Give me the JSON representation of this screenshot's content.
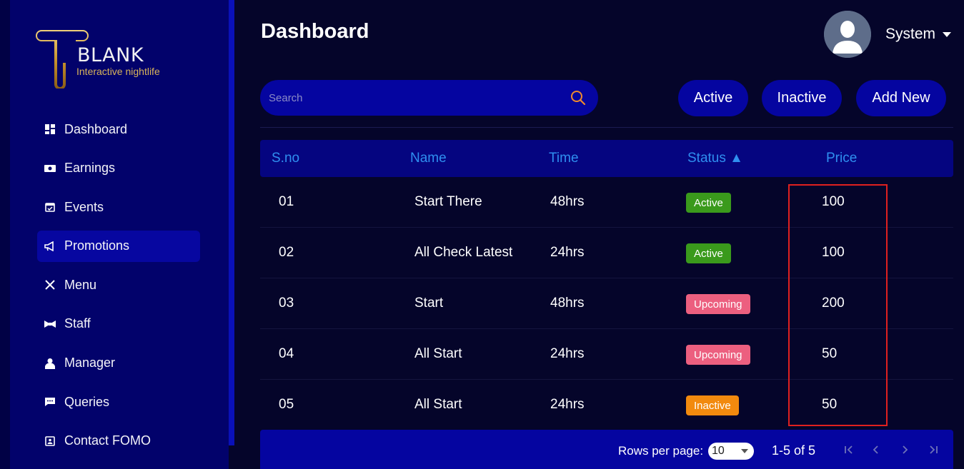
{
  "brand": {
    "name": "BLANK",
    "tagline": "Interactive nightlife"
  },
  "sidebar": {
    "items": [
      {
        "label": "Dashboard",
        "icon": "dashboard-icon",
        "active": false
      },
      {
        "label": "Earnings",
        "icon": "money-icon",
        "active": false
      },
      {
        "label": "Events",
        "icon": "calendar-icon",
        "active": false
      },
      {
        "label": "Promotions",
        "icon": "megaphone-icon",
        "active": true
      },
      {
        "label": "Menu",
        "icon": "utensils-icon",
        "active": false
      },
      {
        "label": "Staff",
        "icon": "bowtie-icon",
        "active": false
      },
      {
        "label": "Manager",
        "icon": "manager-icon",
        "active": false
      },
      {
        "label": "Queries",
        "icon": "chat-icon",
        "active": false
      },
      {
        "label": "Contact FOMO",
        "icon": "contact-icon",
        "active": false
      }
    ]
  },
  "header": {
    "title": "Dashboard",
    "user_name": "System"
  },
  "toolbar": {
    "search_placeholder": "Search",
    "active_label": "Active",
    "inactive_label": "Inactive",
    "add_new_label": "Add New"
  },
  "table": {
    "columns": {
      "sno": "S.no",
      "name": "Name",
      "time": "Time",
      "status": "Status ▲",
      "price": "Price"
    },
    "rows": [
      {
        "sno": "01",
        "name": "Start There",
        "time": "48hrs",
        "status": "Active",
        "price": "100"
      },
      {
        "sno": "02",
        "name": "All Check Latest",
        "time": "24hrs",
        "status": "Active",
        "price": "100"
      },
      {
        "sno": "03",
        "name": "Start",
        "time": "48hrs",
        "status": "Upcoming",
        "price": "200"
      },
      {
        "sno": "04",
        "name": "All Start",
        "time": "24hrs",
        "status": "Upcoming",
        "price": "50"
      },
      {
        "sno": "05",
        "name": "All Start",
        "time": "24hrs",
        "status": "Inactive",
        "price": "50"
      }
    ],
    "status_colors": {
      "Active": "#3a9a1c",
      "Upcoming": "#ec5f7f",
      "Inactive": "#f28a0e"
    }
  },
  "pagination": {
    "rows_per_page_label": "Rows per page:",
    "rows_per_page_value": "10",
    "range": "1-5 of 5"
  },
  "colors": {
    "background": "#05052a",
    "sidebar": "#02026b",
    "accent": "#0505a0",
    "header_text": "#2f8ff0",
    "highlight": "#e0201f"
  }
}
